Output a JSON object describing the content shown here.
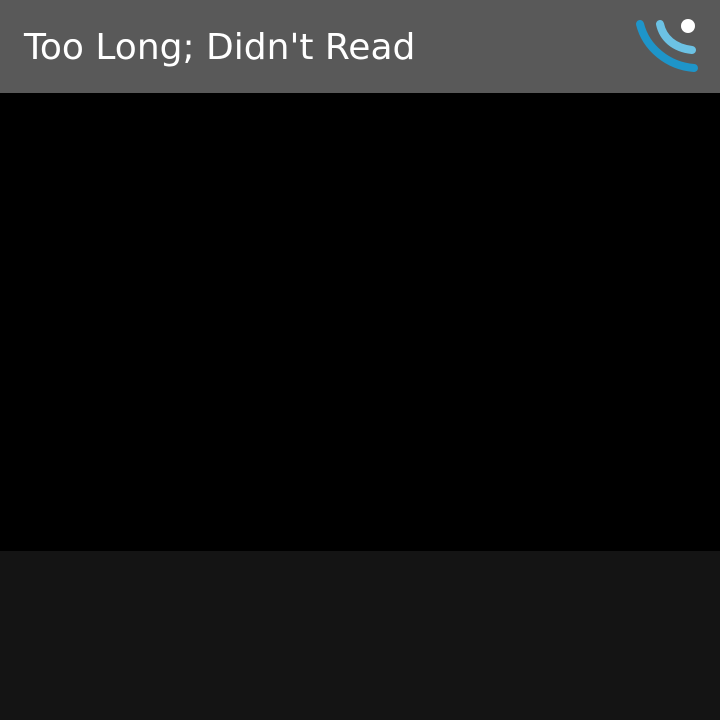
{
  "header": {
    "title": "Too Long; Didn't Read",
    "logo_icon": "app-logo-icon"
  },
  "colors": {
    "title_bar": "#595959",
    "title_text": "#ffffff",
    "content_background": "#000000",
    "bottom_panel": "#141414",
    "logo_dark_blue": "#1e95c9",
    "logo_light_blue": "#6cc2e4",
    "logo_dot": "#ffffff"
  }
}
